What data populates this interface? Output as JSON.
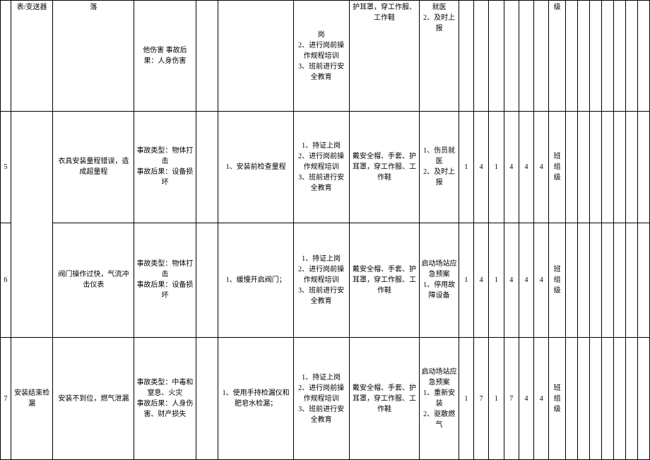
{
  "header_fragments": {
    "task_col": "表/变送器",
    "desc_col": "落",
    "acc_col": "他伤害 事故后果：人身伤害",
    "train_col": "岗\n2、进行岗前操作规程培训\n3、班前进行安全教育",
    "ppe_col": "护耳罩，穿工作服、工作鞋",
    "emg_col": "就医\n2、及时上报",
    "lvl_col": "级"
  },
  "rows": [
    {
      "idx": "5",
      "desc": "衣具安装量程错误，造成超量程",
      "accident": "事故类型：物体打击\n事故后果：设备损坏",
      "control": "1、安装前检查量程",
      "training": "1、持证上岗\n2、进行岗前操作规程培训\n3、班前进行安全教育",
      "ppe": "戴安全帽、手套、护耳罩，穿工作服、工作鞋",
      "emergency": "1、伤员就医\n2、及时上报",
      "nums": [
        "1",
        "4",
        "1",
        "4",
        "4",
        "4"
      ],
      "level": "班组级"
    },
    {
      "idx": "6",
      "desc": "阀门操作过快，气流冲击仪表",
      "accident": "事故类型：物体打击\n事故后果：设备损坏",
      "control": "1、缓慢开启阀门；",
      "training": "1、持证上岗\n2、进行岗前操作规程培训\n3、班前进行安全教育",
      "ppe": "戴安全帽、手套、护耳罩，穿工作服、工作鞋",
      "emergency": "启动场站应急预案\n1、停用故障设备",
      "nums": [
        "1",
        "4",
        "1",
        "4",
        "4",
        "4"
      ],
      "level": "班组级"
    },
    {
      "idx": "7",
      "task": "安装结束检漏",
      "desc": "安装不到位，燃气泄漏",
      "accident": "事故类型：中毒和窒息、火灾\n事故后果：人身伤害、财产损失",
      "control": "1、使用手持检漏仪和肥皂水检漏；",
      "training": "1、持证上岗\n2、进行岗前操作规程培训\n3、班前进行安全教育",
      "ppe": "戴安全帽、手套、护耳罩，穿工作服、工作鞋",
      "emergency": "启动场站应急预案\n1、重新安装\n2、驱散燃气",
      "nums": [
        "1",
        "7",
        "1",
        "7",
        "4",
        "4"
      ],
      "level": "班组级"
    }
  ],
  "tail_cols": 7
}
